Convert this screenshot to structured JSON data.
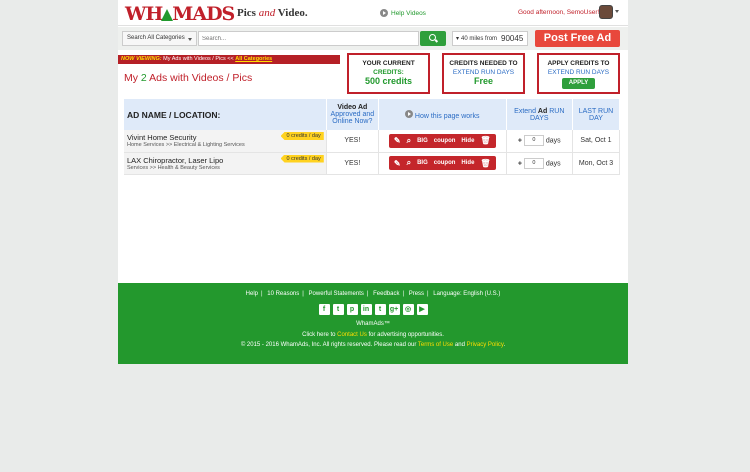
{
  "header": {
    "logo_a": "WH",
    "logo_b": "MADS",
    "tagline_a": "Pics ",
    "tagline_and": "and",
    "tagline_b": " Video.",
    "help_videos": "Help Videos",
    "greeting": "Good afternoon, SemoUser!"
  },
  "search": {
    "category": "Search All Categories",
    "placeholder": "Search...",
    "miles": "40 miles from",
    "zip": "90045",
    "post_ad": "Post Free Ad"
  },
  "now_viewing": {
    "label": "NOW VIEWING:",
    "text": " My Ads with Videos / Pics << ",
    "link": "All Categories"
  },
  "heading": {
    "prefix": "My ",
    "count": "2",
    "suffix": " Ads with Videos / Pics"
  },
  "boxes": {
    "current": {
      "l1": "YOUR CURRENT",
      "l2": "CREDITS:",
      "value": "500 credits"
    },
    "needed": {
      "l1": "CREDITS NEEDED TO",
      "l2": "EXTEND RUN DAYS",
      "value": "Free"
    },
    "apply": {
      "l1": "APPLY CREDITS TO",
      "l2": "EXTEND RUN DAYS",
      "button": "APPLY"
    }
  },
  "table": {
    "col_name": "AD NAME / LOCATION:",
    "col_video_a": "Video Ad",
    "col_video_b": "Approved and",
    "col_video_c": "Online Now?",
    "col_how": "How this page works",
    "col_extend_a": "Extend ",
    "col_extend_ad": "Ad",
    "col_extend_b": " RUN",
    "col_extend_c": "DAYS",
    "col_last_a": "LAST RUN",
    "col_last_b": "DAY",
    "rows": [
      {
        "title": "Vivint Home Security",
        "sub": "Home Services >> Electrical & Lighting Services",
        "credits": "0 credits / day",
        "approved": "YES!",
        "big": "BIG",
        "coupon": "coupon",
        "hide": "Hide",
        "days_val": "0",
        "days": "days",
        "last": "Sat, Oct 1"
      },
      {
        "title": "LAX Chiropractor, Laser Lipo",
        "sub": "Services >> Health & Beauty Services",
        "credits": "0 credits / day",
        "approved": "YES!",
        "big": "BIG",
        "coupon": "coupon",
        "hide": "Hide",
        "days_val": "0",
        "days": "days",
        "last": "Mon, Oct 3"
      }
    ]
  },
  "footer": {
    "links": [
      "Help",
      "10 Reasons",
      "Powerful Statements",
      "Feedback",
      "Press",
      "Language: English (U.S.)"
    ],
    "brand": "WhamAds™",
    "contact_a": "Click here to ",
    "contact_link": "Contact Us",
    "contact_b": " for advertising opportunities.",
    "copy_a": "© 2015 - 2016 WhamAds, Inc. All rights reserved. Please read our ",
    "terms": "Terms of Use",
    "copy_and": " and ",
    "privacy": "Privacy Policy",
    "copy_end": "."
  }
}
